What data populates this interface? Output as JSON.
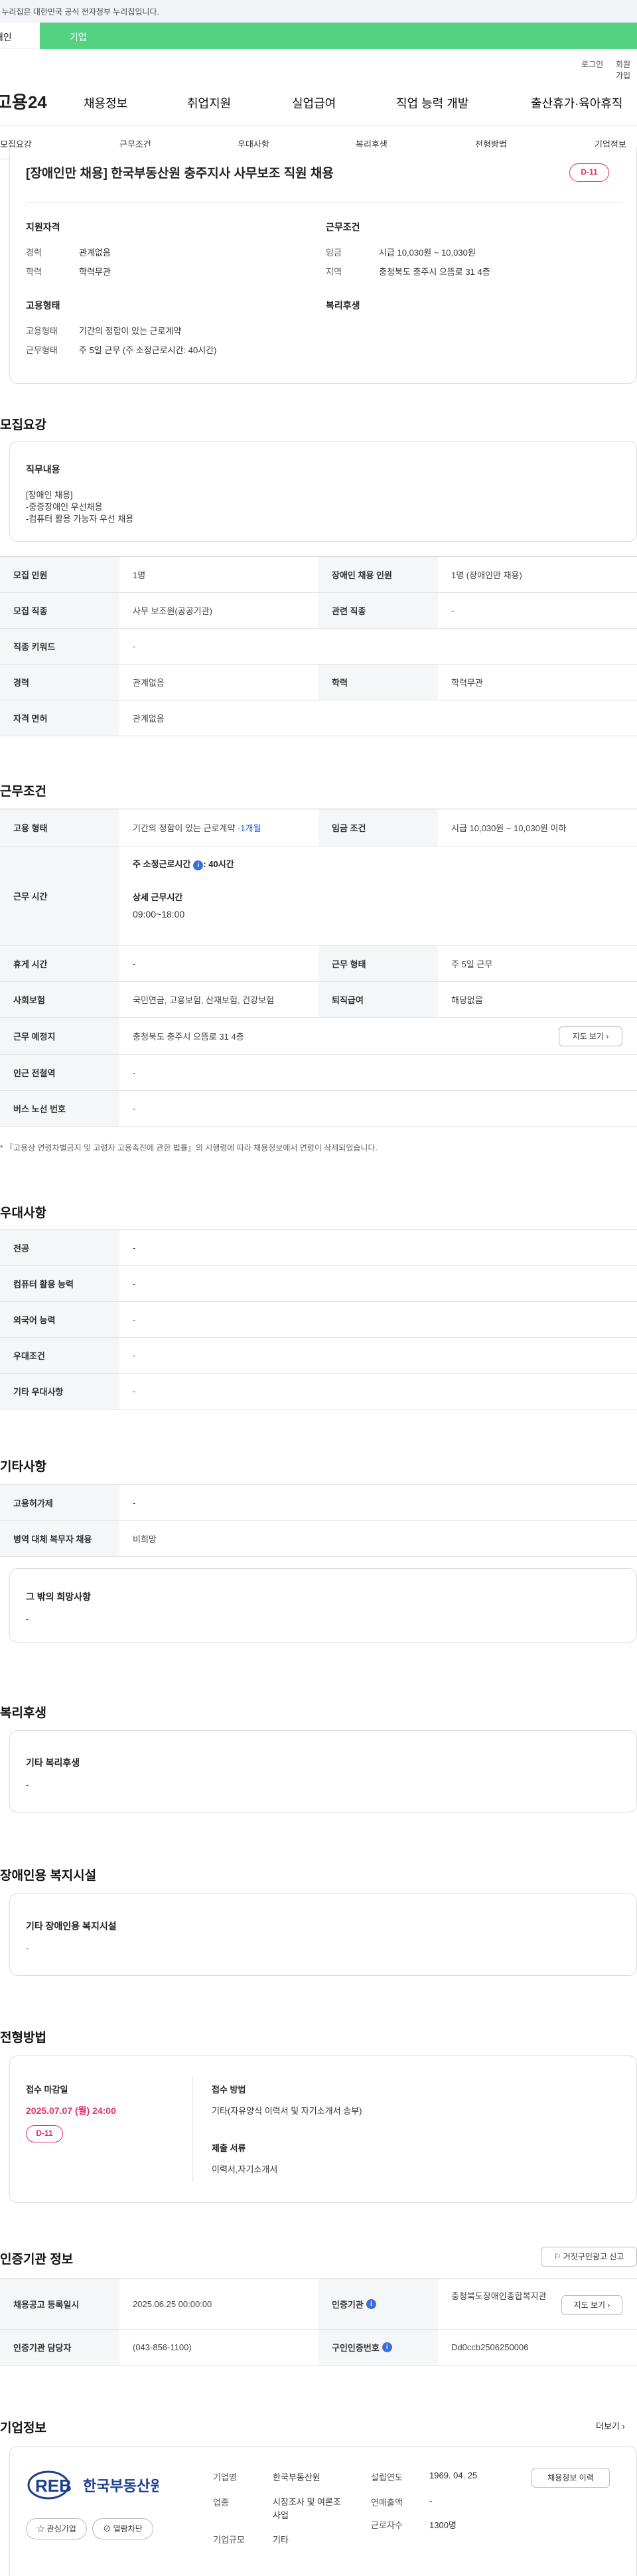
{
  "gov_banner": "이 누리집은 대한민국 공식 전자정부 누리집입니다.",
  "tabs": {
    "person": "개인",
    "company": "기업"
  },
  "util": {
    "login": "로그인",
    "join": "회원가입"
  },
  "logo": "고용24",
  "gnb": [
    "채용정보",
    "취업지원",
    "실업급여",
    "직업 능력 개발",
    "출산휴가·육아휴직"
  ],
  "subnav": [
    "모집요강",
    "근무조건",
    "우대사항",
    "복리후생",
    "전형방법",
    "기업정보"
  ],
  "job": {
    "title": "[장애인만 채용] 한국부동산원 충주지사 사무보조 직원 채용",
    "dday": "D-11",
    "qual_h": "지원자격",
    "career_l": "경력",
    "career_v": "관계없음",
    "edu_l": "학력",
    "edu_v": "학력무관",
    "cond_h": "근무조건",
    "wage_l": "임금",
    "wage_v": "시급 10,030원 ~ 10,030원",
    "region_l": "지역",
    "region_v": "충청북도 충주시 으뜸로 31 4층",
    "emp_h": "고용형태",
    "emp_type_l": "고용형태",
    "emp_type_v": "기간의 정함이 있는 근로계약",
    "work_type_l": "근무형태",
    "work_type_v": "주 5일 근무 (주 소정근로시간: 40시간)",
    "welfare_h": "복리후생"
  },
  "recruit": {
    "title": "모집요강",
    "duty_h": "직무내용",
    "duty_lines": [
      "[장애인 채용]",
      "-중증장애인 우선채용",
      "-컴퓨터 활용 가능자 우선 채용"
    ],
    "rows": [
      {
        "k1": "모집 인원",
        "v1": "1명",
        "k2": "장애인 채용 인원",
        "v2": "1명 (장애인만 채용)"
      },
      {
        "k1": "모집 직종",
        "v1": "사무 보조원(공공기관)",
        "k2": "관련 직종",
        "v2": "-"
      },
      {
        "k1": "직종 키워드",
        "v1": "-"
      },
      {
        "k1": "경력",
        "v1": "관계없음",
        "k2": "학력",
        "v2": "학력무관"
      },
      {
        "k1": "자격 면허",
        "v1": "관계없음"
      }
    ]
  },
  "cond": {
    "title": "근무조건",
    "emp_k": "고용 형태",
    "emp_v": "기간의 정함이 있는 근로계약 · ",
    "emp_v2": "1개월",
    "wage_k": "임금 조건",
    "wage_v": "시급 10,030원 ~ 10,030원 이하",
    "time_k": "근무 시간",
    "time_main": "주 소정근로시간",
    "time_main_v": ": 40시간",
    "time_detail_h": "상세 근무시간",
    "time_detail_v": "09:00~18:00",
    "rest_k": "휴게 시간",
    "rest_v": "-",
    "form_k": "근무 형태",
    "form_v": "주 5일 근무",
    "ins_k": "사회보험",
    "ins_v": "국민연금, 고용보험, 산재보험, 건강보험",
    "ret_k": "퇴직급여",
    "ret_v": "해당없음",
    "place_k": "근무 예정지",
    "place_v": "충청북도 충주시 으뜸로 31 4층",
    "map_btn": "지도 보기",
    "subway_k": "인근 전철역",
    "subway_v": "-",
    "bus_k": "버스 노선 번호",
    "bus_v": "-",
    "note": "* 『고용상 연령차별금지 및 고령자 고용촉진에 관한 법률』의 시행령에 따라 채용정보에서 연령이 삭제되었습니다."
  },
  "pref": {
    "title": "우대사항",
    "rows": [
      {
        "k": "전공",
        "v": "-"
      },
      {
        "k": "컴퓨터 활용 능력",
        "v": "-"
      },
      {
        "k": "외국어 능력",
        "v": "-"
      },
      {
        "k": "우대조건",
        "v": "-"
      },
      {
        "k": "기타 우대사항",
        "v": "-"
      }
    ]
  },
  "etc": {
    "title": "기타사항",
    "rows": [
      {
        "k": "고용허가제",
        "v": "-"
      },
      {
        "k": "병역 대체 복무자 채용",
        "v": "비희망"
      }
    ],
    "wish_h": "그 밖의 희망사항",
    "wish_v": "-"
  },
  "welfare": {
    "title": "복리후생",
    "box_h": "기타 복리후생",
    "box_v": "-"
  },
  "disab": {
    "title": "장애인용 복지시설",
    "box_h": "기타 장애인용 복지시설",
    "box_v": "-"
  },
  "screen": {
    "title": "전형방법",
    "deadline_h": "접수 마감일",
    "deadline_v": "2025.07.07 (월) 24:00",
    "dday": "D-11",
    "method_h": "접수 방법",
    "method_v": "기타(자유양식 이력서 및 자기소개서 송부)",
    "docs_h": "제출 서류",
    "docs_v": "이력서,자기소개서"
  },
  "cert": {
    "title": "인증기관 정보",
    "report_btn": "거짓구인광고 신고",
    "reg_k": "채용공고 등록일시",
    "reg_v": "2025.06.25 00:00:00",
    "org_k": "인증기관",
    "org_v": "충청북도장애인종합복지관",
    "map_btn": "지도 보기",
    "mgr_k": "인증기관 담당자",
    "mgr_v": "(043-856-1100)",
    "no_k": "구인인증번호",
    "no_v": "Dd0ccb2506250006"
  },
  "company": {
    "title": "기업정보",
    "more": "더보기",
    "logo_mark": "REB",
    "logo_name": "한국부동산원",
    "fav_btn": "관심기업",
    "block_btn": "열람차단",
    "name_k": "기업명",
    "name_v": "한국부동산원",
    "ind_k": "업종",
    "ind_v": "시장조사 및 여론조사업",
    "size_k": "기업규모",
    "size_v": "기타",
    "est_k": "설립연도",
    "est_v": "1969. 04. 25",
    "sales_k": "연매출액",
    "sales_v": "-",
    "emp_k": "근로자수",
    "emp_v": "1300명",
    "info_btn": "채용정보 이력"
  }
}
